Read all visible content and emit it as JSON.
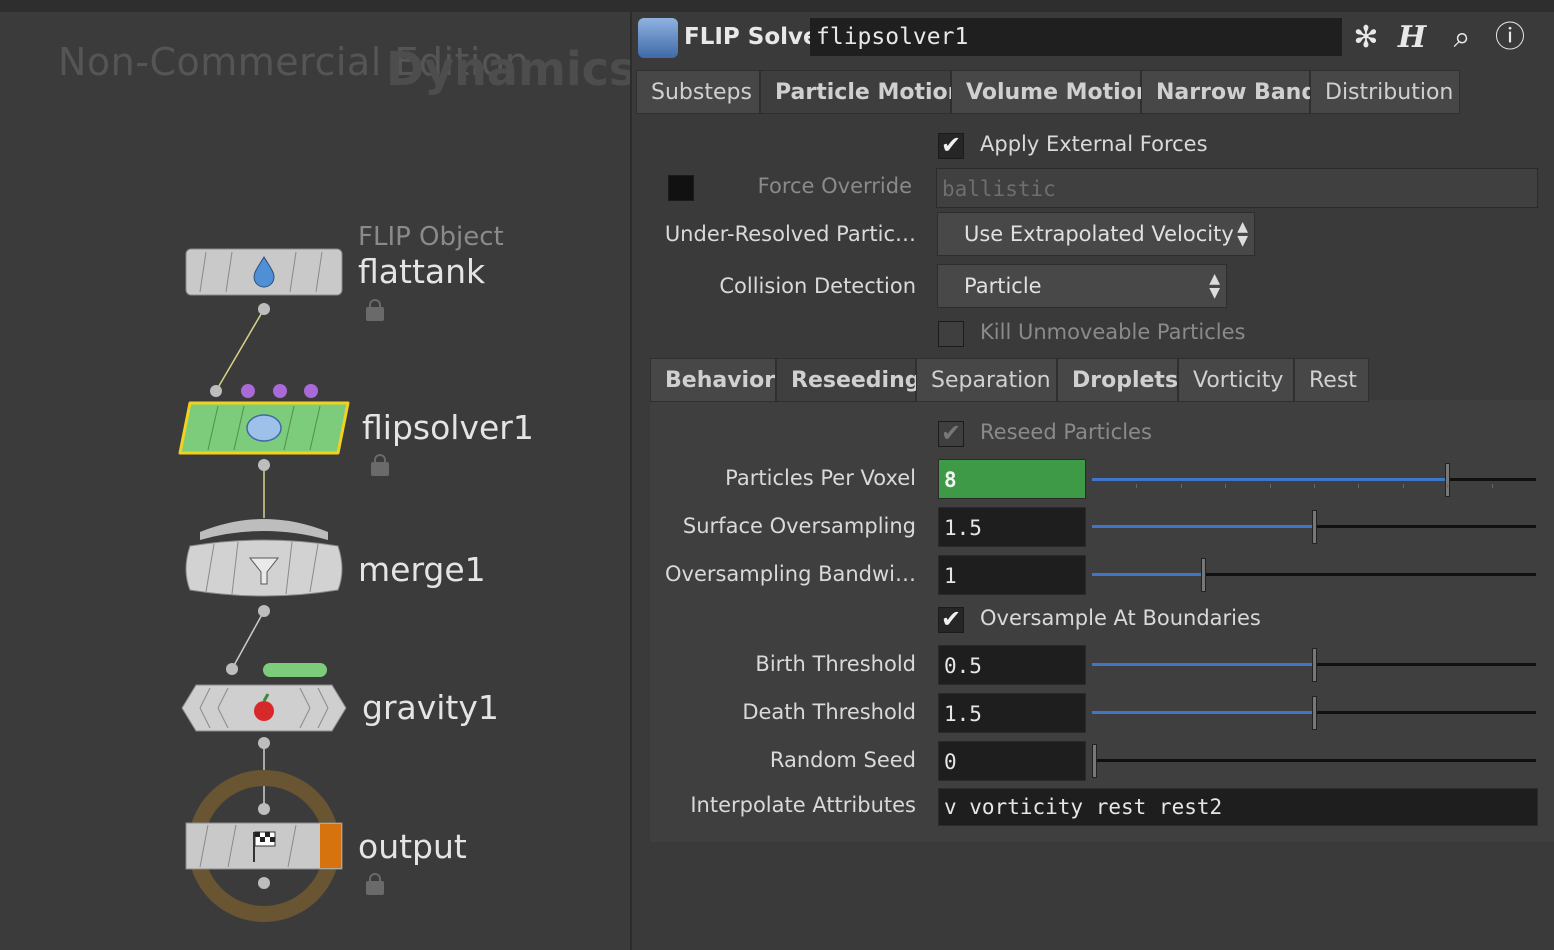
{
  "network": {
    "watermark": "Non-Commercial Edition",
    "context": "Dynamics",
    "nodes": {
      "flattank": {
        "sub": "FLIP Object",
        "name": "flattank"
      },
      "flipsolver": {
        "name": "flipsolver1"
      },
      "merge": {
        "name": "merge1"
      },
      "gravity": {
        "name": "gravity1"
      },
      "output": {
        "name": "output"
      }
    }
  },
  "header": {
    "type": "FLIP Solver",
    "name": "flipsolver1",
    "icons": [
      "gear-icon",
      "houdini-h-icon",
      "search-icon",
      "info-icon"
    ]
  },
  "tabs_main": [
    "Substeps",
    "Particle Motion",
    "Volume Motion",
    "Narrow Band",
    "Distribution"
  ],
  "particle_motion": {
    "apply_external_forces": {
      "label": "Apply External Forces",
      "checked": true
    },
    "force_override": {
      "label": "Force Override",
      "value": "ballistic",
      "enabled": false
    },
    "under_resolved": {
      "label": "Under-Resolved Partic…",
      "value": "Use Extrapolated Velocity"
    },
    "collision_detection": {
      "label": "Collision Detection",
      "value": "Particle"
    },
    "kill_unmoveable": {
      "label": "Kill Unmoveable Particles",
      "checked": false
    }
  },
  "tabs_sub": [
    "Behavior",
    "Reseeding",
    "Separation",
    "Droplets",
    "Vorticity",
    "Rest"
  ],
  "reseeding": {
    "reseed_particles": {
      "label": "Reseed Particles",
      "checked": true
    },
    "particles_per_voxel": {
      "label": "Particles Per Voxel",
      "value": "8",
      "level": 0.8
    },
    "surface_oversampling": {
      "label": "Surface Oversampling",
      "value": "1.5",
      "level": 0.5
    },
    "oversampling_bandwidth": {
      "label": "Oversampling Bandwi…",
      "value": "1",
      "level": 0.25
    },
    "oversample_boundaries": {
      "label": "Oversample At Boundaries",
      "checked": true
    },
    "birth_threshold": {
      "label": "Birth Threshold",
      "value": "0.5",
      "level": 0.5
    },
    "death_threshold": {
      "label": "Death Threshold",
      "value": "1.5",
      "level": 0.5
    },
    "random_seed": {
      "label": "Random Seed",
      "value": "0",
      "level": 0.0
    },
    "interpolate_attributes": {
      "label": "Interpolate Attributes",
      "value": "v vorticity rest rest2"
    }
  },
  "colors": {
    "selected_node": "#7ccc7c",
    "selection_outline": "#f2d21e",
    "slider_fill": "#3f76c8",
    "green_field": "#3f9a48"
  }
}
